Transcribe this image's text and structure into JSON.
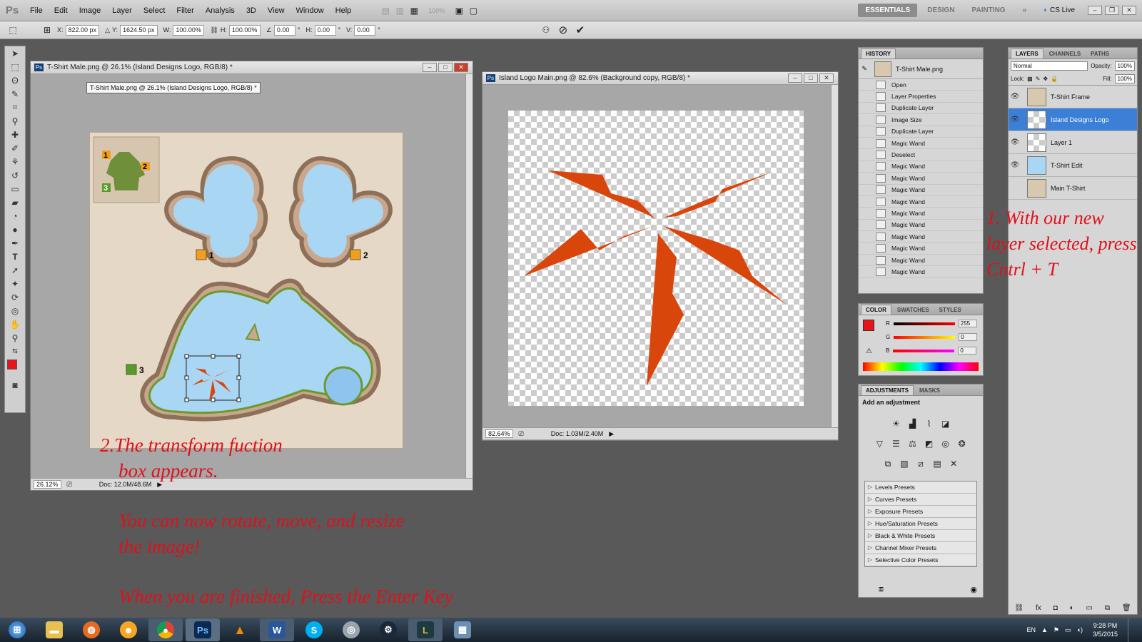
{
  "app": {
    "logo_text": "Ps"
  },
  "menu": [
    "File",
    "Edit",
    "Image",
    "Layer",
    "Select",
    "Filter",
    "Analysis",
    "3D",
    "View",
    "Window",
    "Help"
  ],
  "menu_zoom": "100%",
  "workspaces": [
    "ESSENTIALS",
    "DESIGN",
    "PAINTING"
  ],
  "cslive": "CS Live",
  "options": {
    "x_label": "X:",
    "x": "822.00 px",
    "y_label": "Y:",
    "y": "1624.50 px",
    "w_label": "W:",
    "w": "100.00%",
    "h_label": "H:",
    "h": "100.00%",
    "angle": "0.00",
    "hskew_label": "H:",
    "hskew": "0.00",
    "vskew_label": "V:",
    "vskew": "0.00"
  },
  "doc1": {
    "title": "T-Shirt Male.png @ 26.1% (Island Designs Logo, RGB/8) *",
    "tooltip": "T-Shirt Male.png @ 26.1% (Island Designs Logo, RGB/8) *",
    "zoom": "26.12%",
    "docsize": "Doc: 12.0M/48.6M",
    "labels": [
      "1",
      "2",
      "3"
    ]
  },
  "doc2": {
    "title": "Island Logo Main.png @ 82.6% (Background copy, RGB/8) *",
    "zoom": "82.64%",
    "docsize": "Doc: 1.03M/2.40M"
  },
  "history": {
    "tabs": [
      "HISTORY"
    ],
    "snapshot": "T-Shirt Male.png",
    "items": [
      "Open",
      "Layer Properties",
      "Duplicate Layer",
      "Image Size",
      "Duplicate Layer",
      "Magic Wand",
      "Deselect",
      "Magic Wand",
      "Magic Wand",
      "Magic Wand",
      "Magic Wand",
      "Magic Wand",
      "Magic Wand",
      "Magic Wand",
      "Magic Wand",
      "Magic Wand",
      "Magic Wand"
    ]
  },
  "color": {
    "tabs": [
      "COLOR",
      "SWATCHES",
      "STYLES"
    ],
    "r_label": "R",
    "g_label": "G",
    "b_label": "B",
    "r": "255",
    "g": "0",
    "b": "0",
    "fg": "#e8141c"
  },
  "adjustments": {
    "tabs": [
      "ADJUSTMENTS",
      "MASKS"
    ],
    "heading": "Add an adjustment",
    "presets": [
      "Levels Presets",
      "Curves Presets",
      "Exposure Presets",
      "Hue/Saturation Presets",
      "Black & White Presets",
      "Channel Mixer Presets",
      "Selective Color Presets"
    ]
  },
  "layers": {
    "tabs": [
      "LAYERS",
      "CHANNELS",
      "PATHS"
    ],
    "blend": "Normal",
    "opacity_label": "Opacity:",
    "opacity": "100%",
    "lock_label": "Lock:",
    "fill_label": "Fill:",
    "fill": "100%",
    "items": [
      {
        "name": "T-Shirt Frame",
        "visible": true
      },
      {
        "name": "Island Designs Logo",
        "visible": true,
        "selected": true
      },
      {
        "name": "Layer 1",
        "visible": true
      },
      {
        "name": "T-Shirt Edit",
        "visible": true
      },
      {
        "name": "Main T-Shirt",
        "visible": false
      }
    ]
  },
  "notes": {
    "n1": "1. With our new layer selected, press Cntrl + T",
    "n2a": "2.The transform fuction",
    "n2b": "box appears.",
    "n3a": "You can now rotate, move, and resize",
    "n3b": "the image!",
    "n4": "When you are finished, Press the Enter Key"
  },
  "taskbar": {
    "lang": "EN",
    "time": "9:28 PM",
    "date": "3/5/2015",
    "apps": [
      "start",
      "explorer",
      "firefox",
      "browser",
      "chrome",
      "photoshop",
      "vlc",
      "word",
      "skype",
      "media",
      "steam",
      "league",
      "network"
    ]
  },
  "colors": {
    "accent_red": "#e0101a",
    "logo_orange": "#d9460b",
    "selection_blue": "#3b7fd6"
  }
}
